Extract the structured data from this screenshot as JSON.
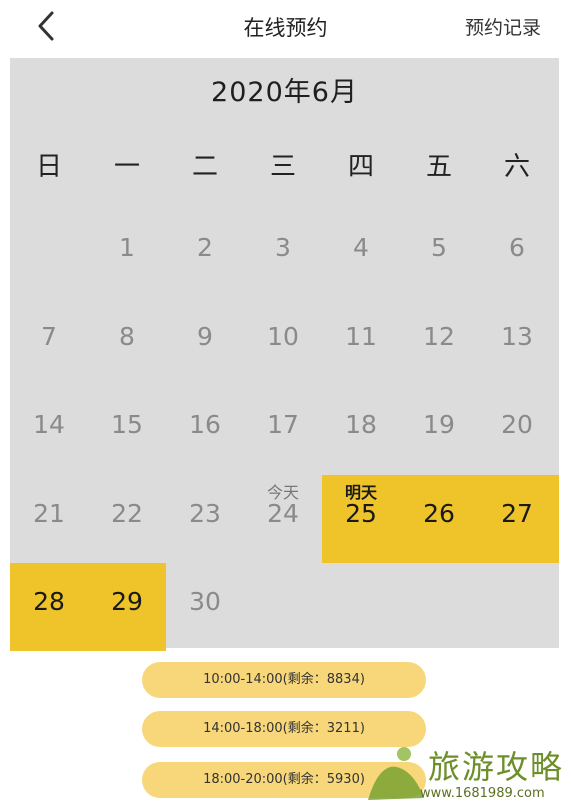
{
  "header": {
    "title": "在线预约",
    "records_label": "预约记录"
  },
  "calendar": {
    "month_label": "2020年6月",
    "weekdays": [
      "日",
      "一",
      "二",
      "三",
      "四",
      "五",
      "六"
    ],
    "days": [
      {
        "day": "1",
        "tag": "",
        "highlight": false
      },
      {
        "day": "2",
        "tag": "",
        "highlight": false
      },
      {
        "day": "3",
        "tag": "",
        "highlight": false
      },
      {
        "day": "4",
        "tag": "",
        "highlight": false
      },
      {
        "day": "5",
        "tag": "",
        "highlight": false
      },
      {
        "day": "6",
        "tag": "",
        "highlight": false
      },
      {
        "day": "7",
        "tag": "",
        "highlight": false
      },
      {
        "day": "8",
        "tag": "",
        "highlight": false
      },
      {
        "day": "9",
        "tag": "",
        "highlight": false
      },
      {
        "day": "10",
        "tag": "",
        "highlight": false
      },
      {
        "day": "11",
        "tag": "",
        "highlight": false
      },
      {
        "day": "12",
        "tag": "",
        "highlight": false
      },
      {
        "day": "13",
        "tag": "",
        "highlight": false
      },
      {
        "day": "14",
        "tag": "",
        "highlight": false
      },
      {
        "day": "15",
        "tag": "",
        "highlight": false
      },
      {
        "day": "16",
        "tag": "",
        "highlight": false
      },
      {
        "day": "17",
        "tag": "",
        "highlight": false
      },
      {
        "day": "18",
        "tag": "",
        "highlight": false
      },
      {
        "day": "19",
        "tag": "",
        "highlight": false
      },
      {
        "day": "20",
        "tag": "",
        "highlight": false
      },
      {
        "day": "21",
        "tag": "",
        "highlight": false
      },
      {
        "day": "22",
        "tag": "",
        "highlight": false
      },
      {
        "day": "23",
        "tag": "",
        "highlight": false
      },
      {
        "day": "24",
        "tag": "今天",
        "highlight": false
      },
      {
        "day": "25",
        "tag": "明天",
        "highlight": true
      },
      {
        "day": "26",
        "tag": "",
        "highlight": true
      },
      {
        "day": "27",
        "tag": "",
        "highlight": true
      },
      {
        "day": "28",
        "tag": "",
        "highlight": true
      },
      {
        "day": "29",
        "tag": "",
        "highlight": true
      },
      {
        "day": "30",
        "tag": "",
        "highlight": false
      }
    ]
  },
  "time_slots": [
    {
      "label": "10:00-14:00(剩余：8834)"
    },
    {
      "label": "14:00-18:00(剩余：3211)"
    },
    {
      "label": "18:00-20:00(剩余：5930)"
    }
  ],
  "watermark": {
    "text": "旅游攻略",
    "url": "www.1681989.com"
  },
  "colors": {
    "highlight": "#efc42b",
    "calendar_bg": "#dcdcdc",
    "slot_bg": "#f7d77a"
  }
}
